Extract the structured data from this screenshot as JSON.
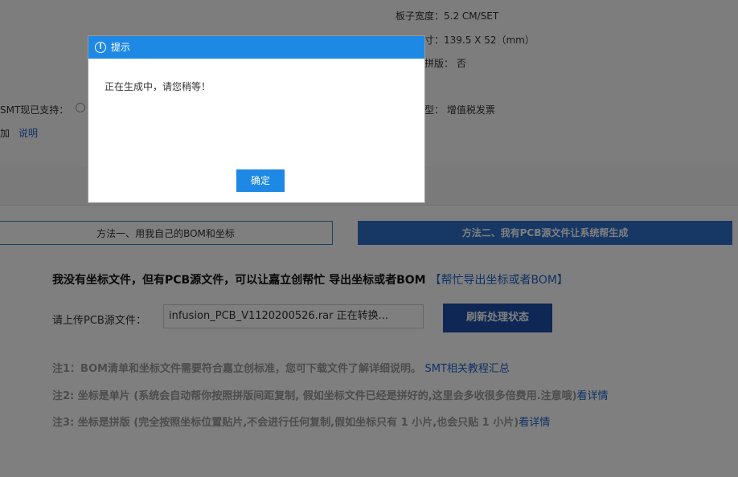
{
  "info_rows": {
    "board_width": "板子宽度：5.2 CM/SET",
    "board_size": "寸：139.5 X 52（mm）",
    "panel": "拼版：  否",
    "smt_support": "SMT现已支持：",
    "invoice_type": "型：  增值税发票",
    "extra_prefix": "加",
    "explain_link": "说明"
  },
  "methods": {
    "method1": "方法一、用我自己的BOM和坐标",
    "method2": "方法二、我有PCB源文件让系统帮生成"
  },
  "main": {
    "heading": "我没有坐标文件，但有PCB源文件，可以让嘉立创帮忙 导出坐标或者BOM",
    "heading_link": "【帮忙导出坐标或者BOM】",
    "upload_label": "请上传PCB源文件：",
    "upload_value": "infusion_PCB_V1120200526.rar  正在转换...",
    "refresh_button": "刷新处理状态"
  },
  "notes": {
    "note1": "注1：BOM清单和坐标文件需要符合嘉立创标准，您可下载文件了解详细说明。",
    "note1_link": "SMT相关教程汇总",
    "note2": "注2: 坐标是单片 (系统会自动帮你按照拼版间距复制, 假如坐标文件已经是拼好的,这里会多收很多倍费用.注意哦)",
    "note2_link": "看详情",
    "note3": "注3: 坐标是拼版 (完全按照坐标位置贴片,不会进行任何复制,假如坐标只有 1 小片,也会只贴 1 小片)",
    "note3_link": "看详情"
  },
  "dialog": {
    "icon": "exclamation-circle-icon",
    "title": "提示",
    "message": "正在生成中，请您稍等！",
    "ok_button": "确定"
  },
  "colors": {
    "dialog_header": "#1e88e5",
    "primary_button": "#1f4fa8",
    "link": "#1e62c7"
  }
}
